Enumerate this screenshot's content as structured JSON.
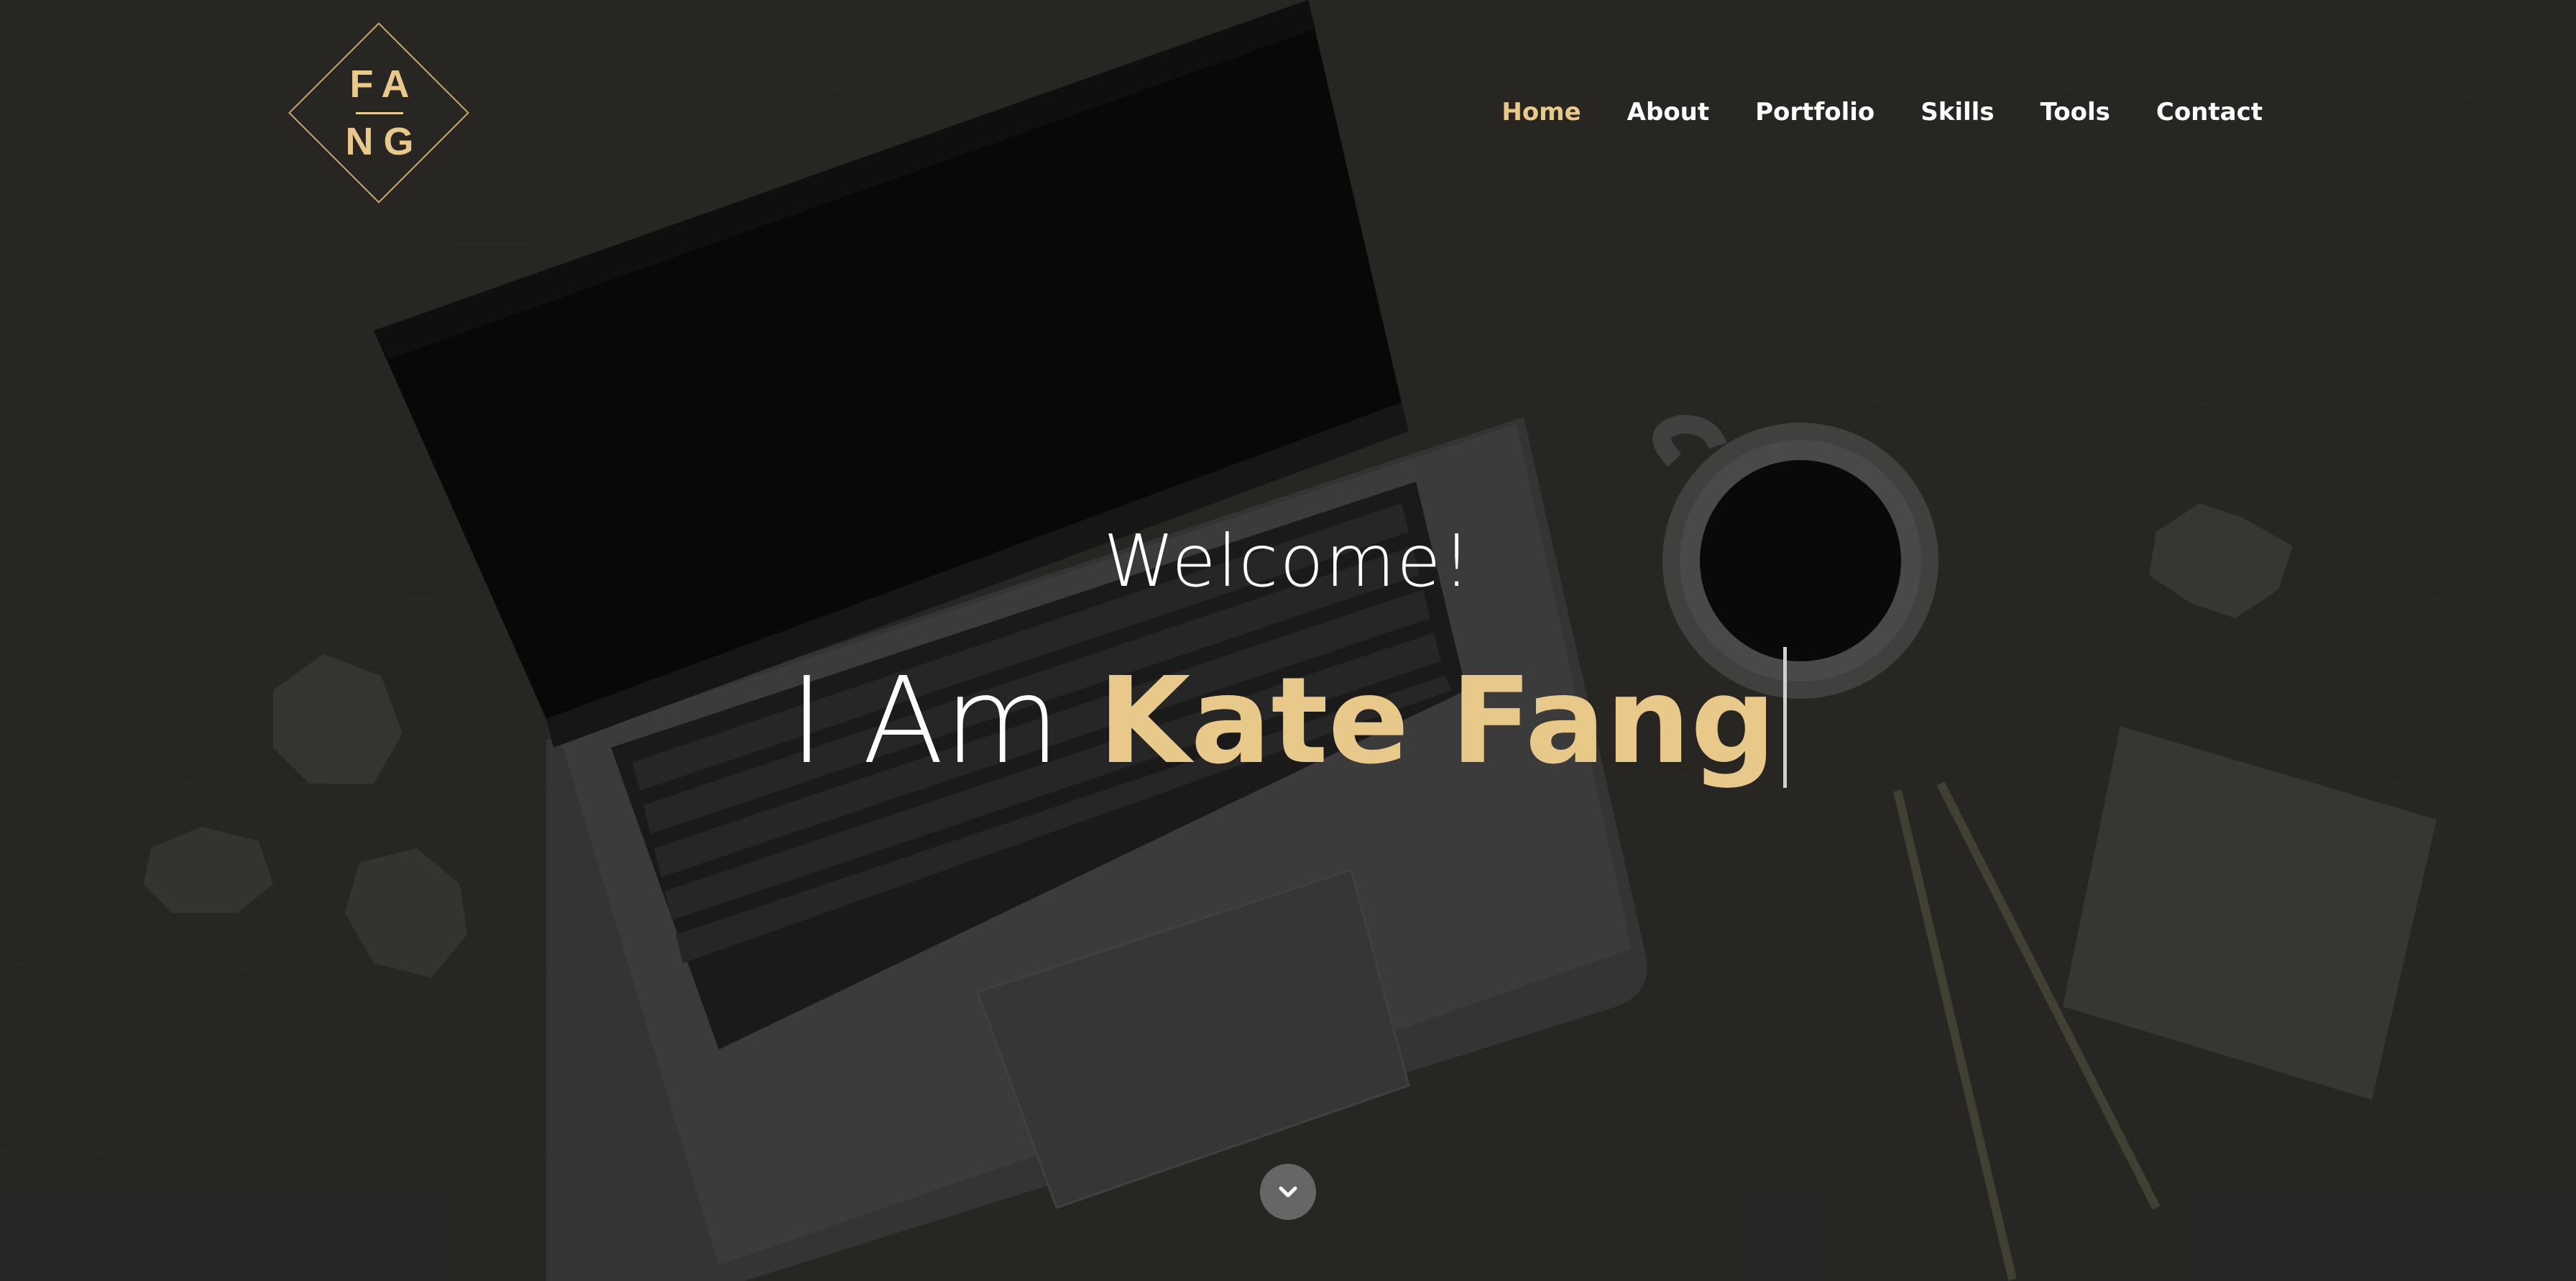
{
  "logo": {
    "line1": "FA",
    "line2": "NG",
    "accent_color": "#e8c98a"
  },
  "nav": {
    "items": [
      {
        "label": "Home",
        "active": true
      },
      {
        "label": "About",
        "active": false
      },
      {
        "label": "Portfolio",
        "active": false
      },
      {
        "label": "Skills",
        "active": false
      },
      {
        "label": "Tools",
        "active": false
      },
      {
        "label": "Contact",
        "active": false
      }
    ],
    "active_color": "#e8c98a"
  },
  "hero": {
    "welcome": "Welcome!",
    "headline_prefix": "I Am ",
    "headline_name": "Kate Fang",
    "background_image": "laptop-coffee-desk-photo"
  },
  "scroll_button": {
    "icon": "chevron-down-icon"
  }
}
